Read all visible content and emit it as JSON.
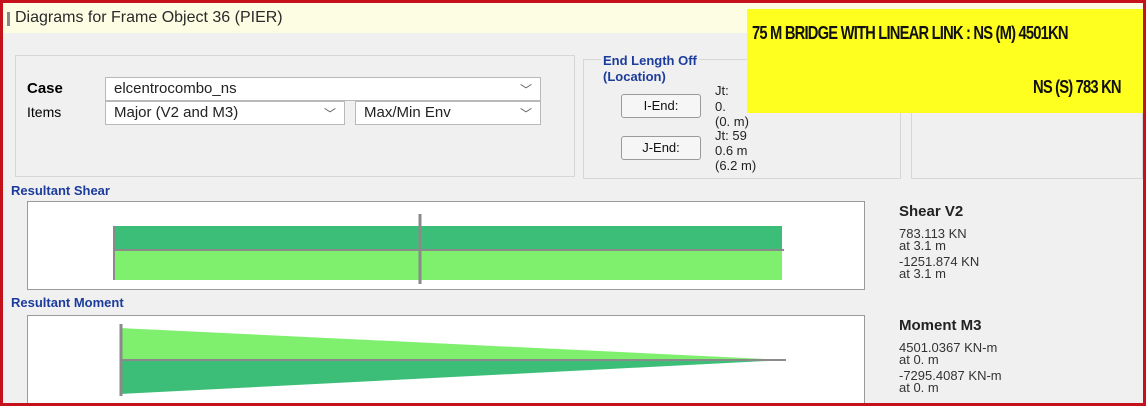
{
  "window": {
    "title": "Diagrams for Frame Object 36  (PIER)"
  },
  "banner": {
    "line1": "75 M BRIDGE WITH LINEAR LINK :   NS  (M)  4501KN",
    "line2": "NS (S)   783 KN",
    "color": "#ffff1f"
  },
  "case": {
    "label": "Case",
    "value": "elcentrocombo_ns"
  },
  "items": {
    "label": "Items",
    "component": "Major (V2 and M3)",
    "envelope": "Max/Min Env"
  },
  "end_length": {
    "title": "End Length Off",
    "subtitle": "(Location)",
    "i_end": {
      "button": "I-End:",
      "jt": "Jt:",
      "value": "0.",
      "location": "(0. m)"
    },
    "j_end": {
      "button": "J-End:",
      "jt": "Jt: 59",
      "value": "0.6 m",
      "location": "(6.2 m)"
    }
  },
  "shear": {
    "section": "Resultant Shear",
    "title": "Shear V2",
    "max_value": "783.113 KN",
    "max_at": "at 3.1 m",
    "min_value": "-1251.874 KN",
    "min_at": "at 3.1 m",
    "positive_color": "#3cbe78",
    "negative_color": "#7ef06e",
    "positive_level": 783.113,
    "negative_level": -1251.874,
    "cursor_location_m": 3.1,
    "length_m": 6.2
  },
  "moment": {
    "section": "Resultant Moment",
    "title": "Moment M3",
    "max_value": "4501.0367 KN-m",
    "max_at": "at 0. m",
    "min_value": "-7295.4087 KN-m",
    "min_at": "at 0. m",
    "positive_color": "#7ef06e",
    "negative_color": "#3cbe78"
  },
  "colors": {
    "frame_border": "#c4111b",
    "section_label": "#1c3c9c"
  }
}
